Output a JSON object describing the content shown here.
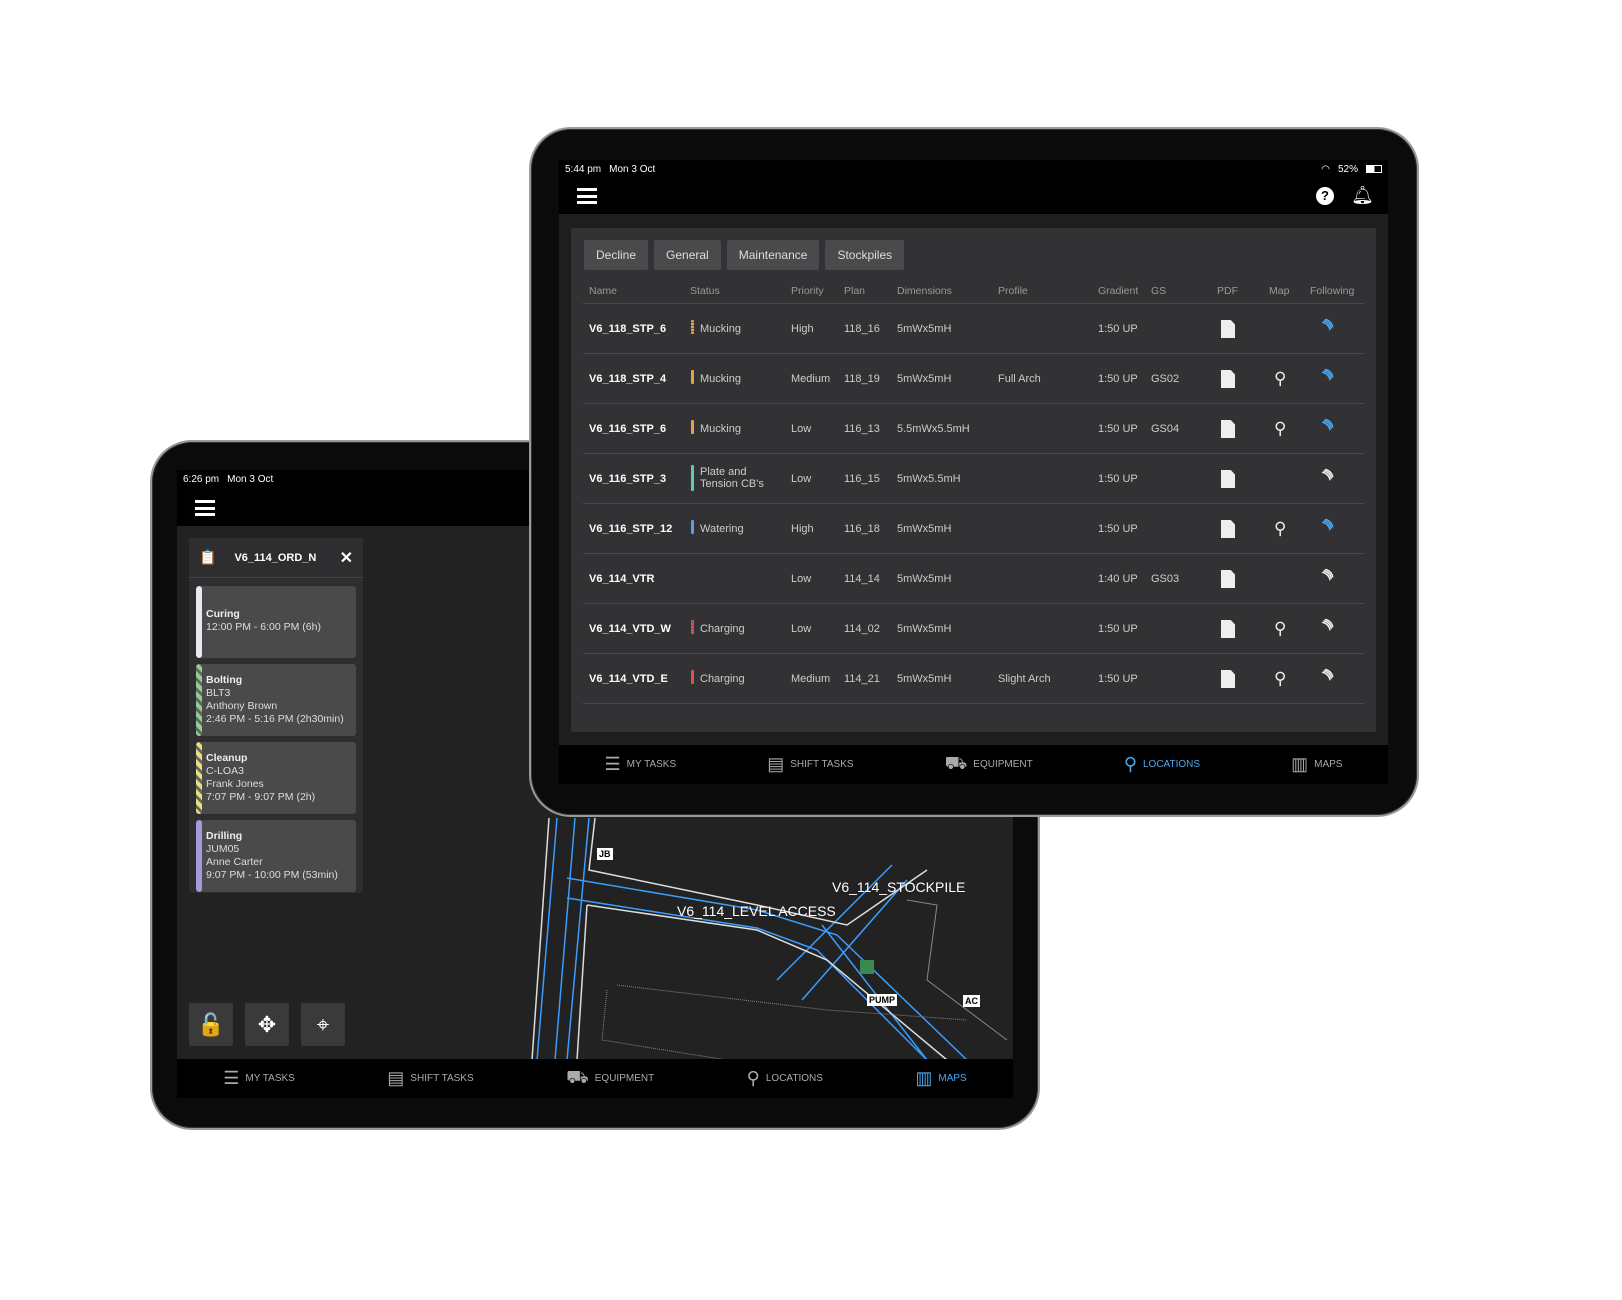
{
  "back_tablet": {
    "status": {
      "time": "6:26 pm",
      "date": "Mon 3 Oct"
    },
    "panel": {
      "title": "V6_114_ORD_N",
      "tasks": [
        {
          "title": "Curing",
          "lines": [
            "12:00 PM - 6:00 PM (6h)"
          ],
          "color": "#e8e8ee",
          "striped": false
        },
        {
          "title": "Bolting",
          "lines": [
            "BLT3",
            "Anthony Brown",
            "2:46 PM - 5:16 PM (2h30min)"
          ],
          "color": "#8fd08f",
          "striped": true
        },
        {
          "title": "Cleanup",
          "lines": [
            "C-LOA3",
            "Frank Jones",
            "7:07 PM - 9:07 PM (2h)"
          ],
          "color": "#e8e07a",
          "striped": true
        },
        {
          "title": "Drilling",
          "lines": [
            "JUM05",
            "Anne Carter",
            "9:07 PM - 10:00 PM (53min)"
          ],
          "color": "#a89ad8",
          "striped": false
        }
      ]
    },
    "tools": [
      {
        "icon": "unlock-icon",
        "glyph": "🔓"
      },
      {
        "icon": "move-icon",
        "glyph": "✥"
      },
      {
        "icon": "location-off-icon",
        "glyph": "⌖"
      }
    ],
    "map": {
      "labels": {
        "level_access": "V6_114_LEVEL ACCESS",
        "stockpile": "V6_114_STOCKPILE",
        "jb": "JB",
        "pump": "PUMP",
        "ac": "AC"
      }
    },
    "nav": [
      {
        "label": "MY TASKS",
        "icon": "tasks-icon",
        "glyph": "☰"
      },
      {
        "label": "SHIFT TASKS",
        "icon": "list-icon",
        "glyph": "▤"
      },
      {
        "label": "EQUIPMENT",
        "icon": "equipment-icon",
        "glyph": "⛟"
      },
      {
        "label": "LOCATIONS",
        "icon": "pin-icon",
        "glyph": "⚲"
      },
      {
        "label": "MAPS",
        "icon": "map-icon",
        "glyph": "▥",
        "active": true
      }
    ]
  },
  "front_tablet": {
    "status": {
      "time": "5:44 pm",
      "date": "Mon 3 Oct",
      "battery": "52%"
    },
    "tabs": [
      "Decline",
      "General",
      "Maintenance",
      "Stockpiles"
    ],
    "columns": [
      "Name",
      "Status",
      "Priority",
      "Plan",
      "Dimensions",
      "Profile",
      "Gradient",
      "GS",
      "PDF",
      "Map",
      "Following"
    ],
    "rows": [
      {
        "name": "V6_118_STP_6",
        "status": "Mucking",
        "status_color": "#e8a040",
        "striped": true,
        "priority": "High",
        "plan": "118_16",
        "dimensions": "5mWx5mH",
        "profile": "",
        "gradient": "1:50 UP",
        "gs": "",
        "map": false,
        "following": true
      },
      {
        "name": "V6_118_STP_4",
        "status": "Mucking",
        "status_color": "#e8a040",
        "priority": "Medium",
        "plan": "118_19",
        "dimensions": "5mWx5mH",
        "profile": "Full Arch",
        "gradient": "1:50 UP",
        "gs": "GS02",
        "map": true,
        "following": true
      },
      {
        "name": "V6_116_STP_6",
        "status": "Mucking",
        "status_color": "#e8a040",
        "priority": "Low",
        "plan": "116_13",
        "dimensions": "5.5mWx5.5mH",
        "profile": "",
        "gradient": "1:50 UP",
        "gs": "GS04",
        "map": true,
        "following": true
      },
      {
        "name": "V6_116_STP_3",
        "status": "Plate and Tension CB's",
        "status_color": "#5fc8b0",
        "priority": "Low",
        "plan": "116_15",
        "dimensions": "5mWx5.5mH",
        "profile": "",
        "gradient": "1:50 UP",
        "gs": "",
        "map": false,
        "following": false
      },
      {
        "name": "V6_116_STP_12",
        "status": "Watering",
        "status_color": "#5a9fe0",
        "priority": "High",
        "plan": "116_18",
        "dimensions": "5mWx5mH",
        "profile": "",
        "gradient": "1:50 UP",
        "gs": "",
        "map": true,
        "following": true
      },
      {
        "name": "V6_114_VTR",
        "status": "",
        "status_color": "",
        "priority": "Low",
        "plan": "114_14",
        "dimensions": "5mWx5mH",
        "profile": "",
        "gradient": "1:40 UP",
        "gs": "GS03",
        "map": false,
        "following": false
      },
      {
        "name": "V6_114_VTD_W",
        "status": "Charging",
        "status_color": "#e05050",
        "striped": true,
        "priority": "Low",
        "plan": "114_02",
        "dimensions": "5mWx5mH",
        "profile": "",
        "gradient": "1:50 UP",
        "gs": "",
        "map": true,
        "following": false
      },
      {
        "name": "V6_114_VTD_E",
        "status": "Charging",
        "status_color": "#e05050",
        "priority": "Medium",
        "plan": "114_21",
        "dimensions": "5mWx5mH",
        "profile": "Slight Arch",
        "gradient": "1:50 UP",
        "gs": "",
        "map": true,
        "following": false
      }
    ],
    "nav": [
      {
        "label": "MY TASKS",
        "icon": "tasks-icon",
        "glyph": "☰"
      },
      {
        "label": "SHIFT TASKS",
        "icon": "list-icon",
        "glyph": "▤"
      },
      {
        "label": "EQUIPMENT",
        "icon": "equipment-icon",
        "glyph": "⛟"
      },
      {
        "label": "LOCATIONS",
        "icon": "pin-icon",
        "glyph": "⚲",
        "active": true
      },
      {
        "label": "MAPS",
        "icon": "map-icon",
        "glyph": "▥"
      }
    ]
  },
  "colors": {
    "accent": "#4aa8f0",
    "panel": "#323235"
  }
}
